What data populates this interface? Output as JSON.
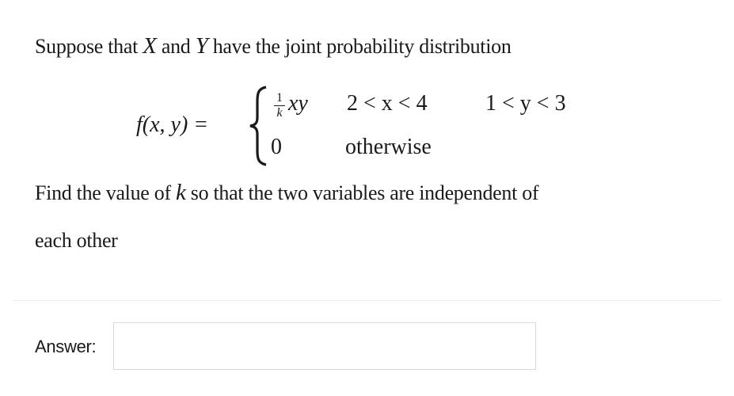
{
  "question": {
    "intro": {
      "before_x": "Suppose that ",
      "var_x": "X",
      "between": " and ",
      "var_y": "Y",
      "after": " have the joint probability distribution"
    },
    "equation": {
      "lhs": "f(x, y) =",
      "case1_numerator": "1",
      "case1_denominator": "k",
      "case1_expr": "xy",
      "case1_cond_x": "2 < x < 4",
      "case1_cond_y": "1 < y < 3",
      "case2_value": "0",
      "case2_cond": "otherwise"
    },
    "prompt": {
      "before_k": "Find the value of ",
      "var_k": "k",
      "after_k": " so that the two variables are independent of",
      "line2": "each other"
    }
  },
  "answer": {
    "label": "Answer:",
    "value": "",
    "placeholder": ""
  }
}
